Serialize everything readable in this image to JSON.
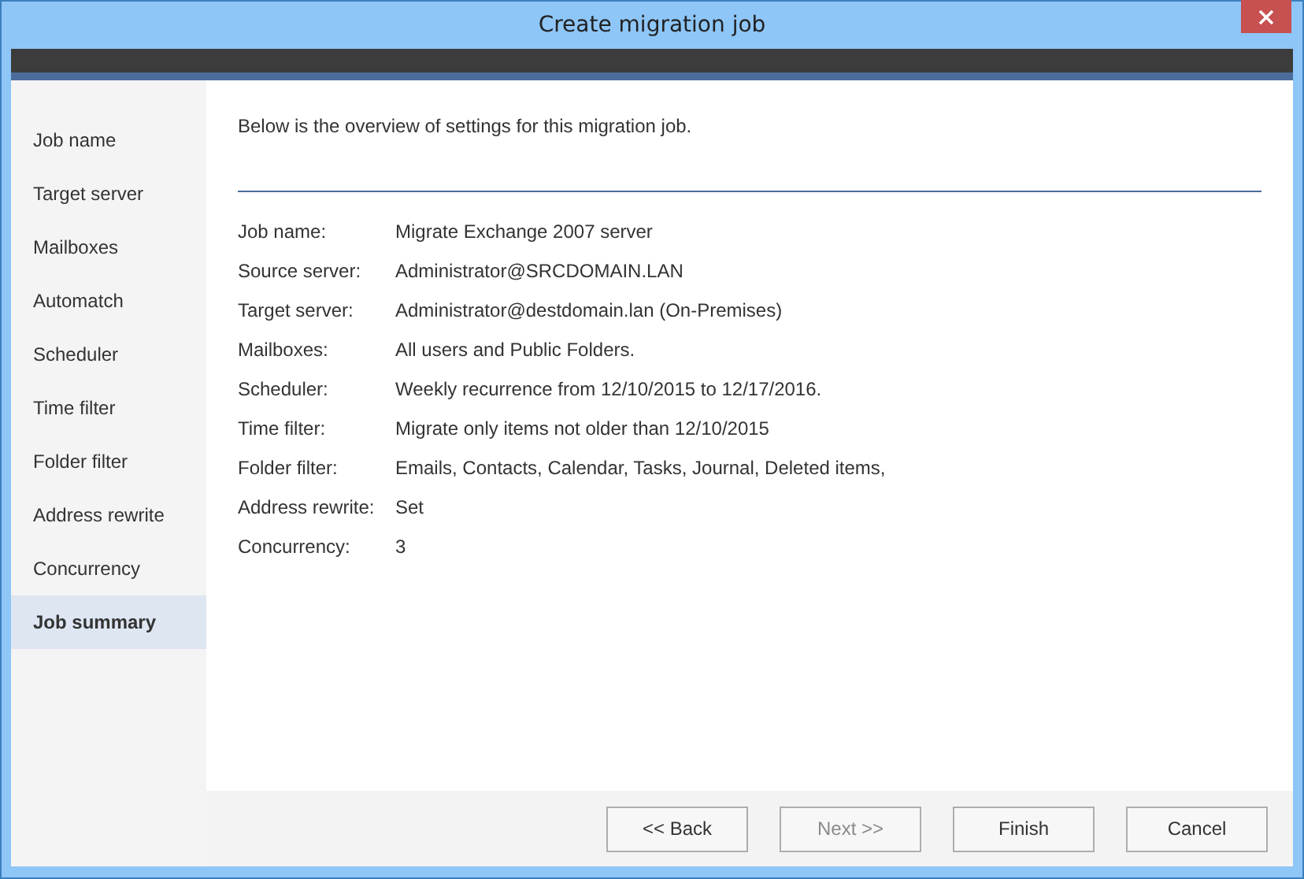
{
  "window": {
    "title": "Create migration job"
  },
  "sidebar": {
    "items": [
      {
        "label": "Job name",
        "selected": false
      },
      {
        "label": "Target server",
        "selected": false
      },
      {
        "label": "Mailboxes",
        "selected": false
      },
      {
        "label": "Automatch",
        "selected": false
      },
      {
        "label": "Scheduler",
        "selected": false
      },
      {
        "label": "Time filter",
        "selected": false
      },
      {
        "label": "Folder filter",
        "selected": false
      },
      {
        "label": "Address rewrite",
        "selected": false
      },
      {
        "label": "Concurrency",
        "selected": false
      },
      {
        "label": "Job summary",
        "selected": true
      }
    ]
  },
  "intro": "Below is the overview of settings for this migration job.",
  "summary": [
    {
      "label": "Job name:",
      "value": "Migrate Exchange 2007 server"
    },
    {
      "label": "Source server:",
      "value": "Administrator@SRCDOMAIN.LAN"
    },
    {
      "label": "Target server:",
      "value": "Administrator@destdomain.lan (On-Premises)"
    },
    {
      "label": "Mailboxes:",
      "value": "All users and Public Folders."
    },
    {
      "label": "Scheduler:",
      "value": "Weekly recurrence from 12/10/2015 to 12/17/2016."
    },
    {
      "label": "Time filter:",
      "value": "Migrate only items not older than 12/10/2015"
    },
    {
      "label": "Folder filter:",
      "value": "Emails, Contacts, Calendar, Tasks, Journal, Deleted items,"
    },
    {
      "label": "Address rewrite:",
      "value": "Set"
    },
    {
      "label": "Concurrency:",
      "value": "3"
    }
  ],
  "buttons": [
    {
      "label": "<< Back",
      "disabled": false
    },
    {
      "label": "Next >>",
      "disabled": true
    },
    {
      "label": "Finish",
      "disabled": false
    },
    {
      "label": "Cancel",
      "disabled": false
    }
  ]
}
